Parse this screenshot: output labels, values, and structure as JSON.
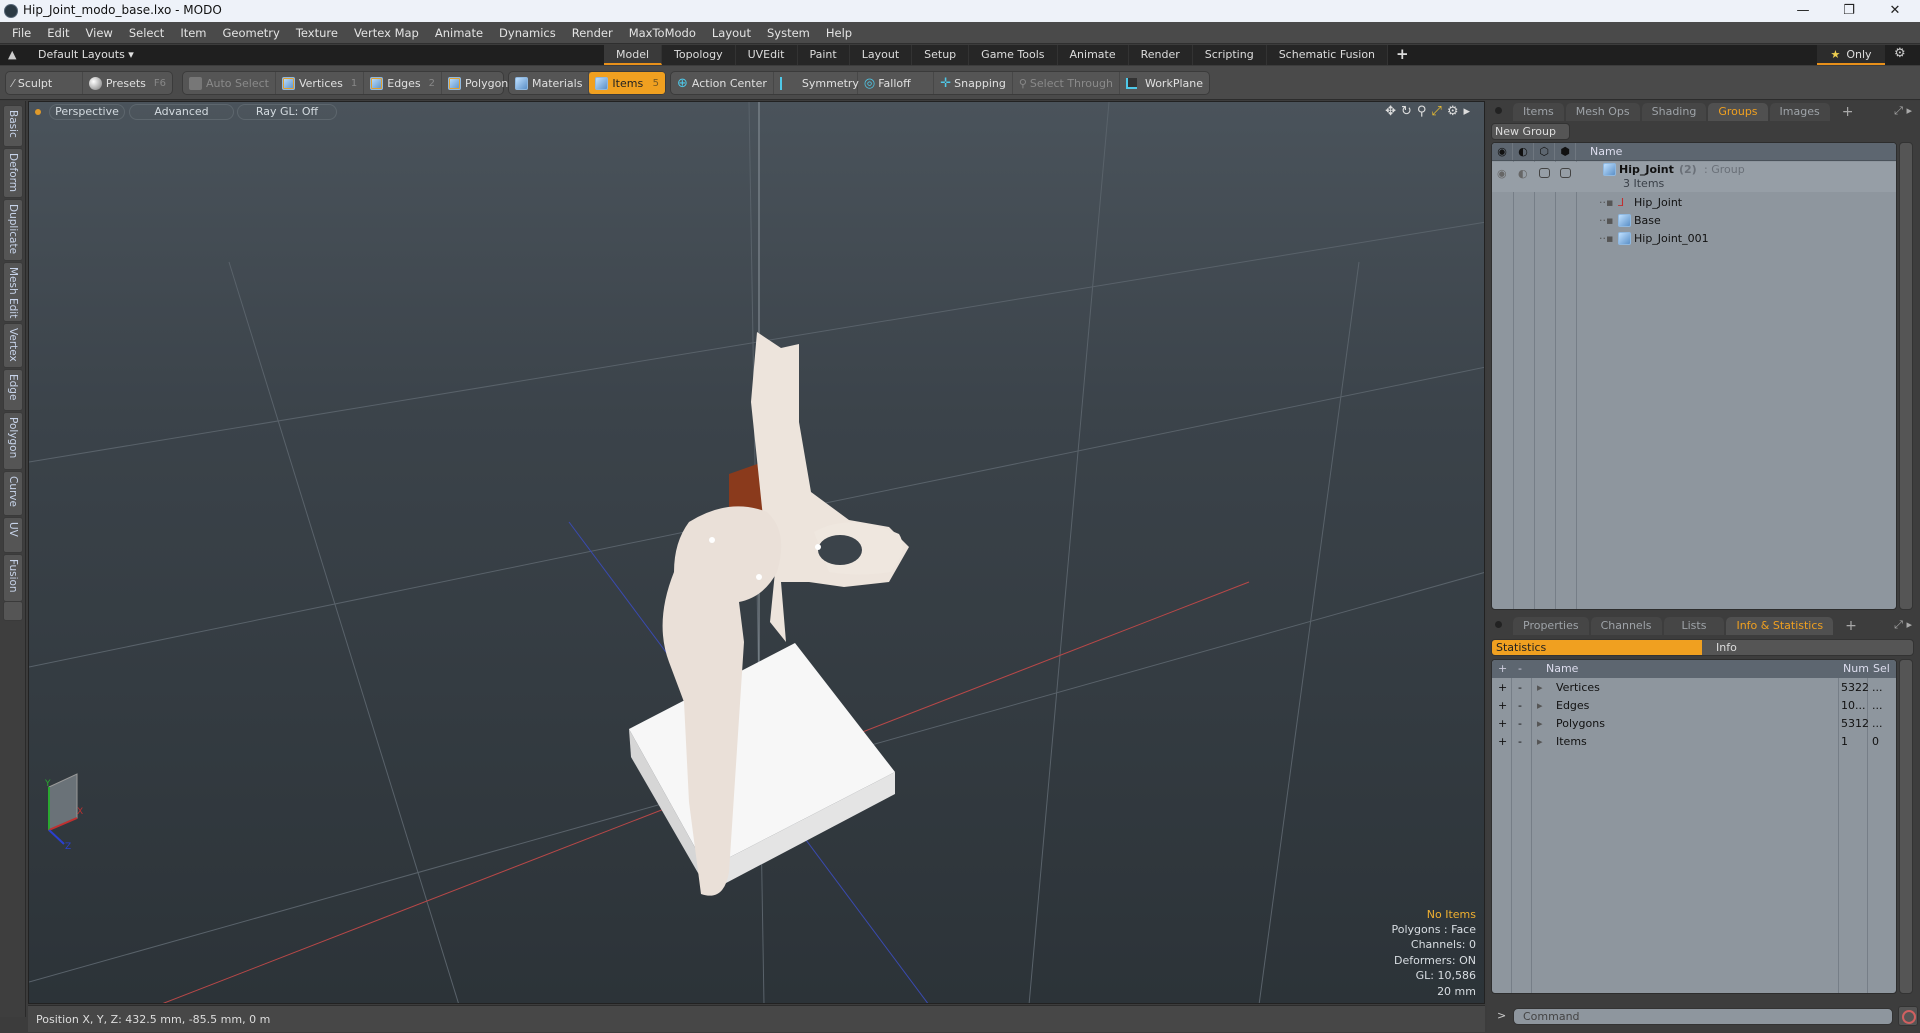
{
  "window": {
    "title": "Hip_Joint_modo_base.lxo - MODO",
    "minimize": "—",
    "maximize": "❐",
    "close": "✕"
  },
  "menu": [
    "File",
    "Edit",
    "View",
    "Select",
    "Item",
    "Geometry",
    "Texture",
    "Vertex Map",
    "Animate",
    "Dynamics",
    "Render",
    "MaxToModo",
    "Layout",
    "System",
    "Help"
  ],
  "layoutbar": {
    "layouts_label": "Default Layouts ▾",
    "tabs": [
      "Model",
      "Topology",
      "UVEdit",
      "Paint",
      "Layout",
      "Setup",
      "Game Tools",
      "Animate",
      "Render",
      "Scripting",
      "Schematic Fusion"
    ],
    "active_tab": "Model",
    "add_tab": "+",
    "only_label": "Only"
  },
  "toolbar": {
    "sculpt": "Sculpt",
    "presets": "Presets",
    "presets_key": "F6",
    "auto_select": "Auto Select",
    "vertices": "Vertices",
    "vertices_key": "1",
    "edges": "Edges",
    "edges_key": "2",
    "polygons": "Polygons",
    "materials": "Materials",
    "items": "Items",
    "items_key": "5",
    "action_center": "Action Center",
    "symmetry": "Symmetry",
    "falloff": "Falloff",
    "snapping": "Snapping",
    "select_through": "Select Through",
    "workplane": "WorkPlane"
  },
  "left_tabs": [
    "Basic",
    "Deform",
    "Duplicate",
    "Mesh Edit",
    "Vertex",
    "Edge",
    "Polygon",
    "Curve",
    "UV",
    "Fusion"
  ],
  "viewport": {
    "view_mode": "Perspective",
    "shading": "Advanced",
    "raygl": "Ray GL: Off",
    "info": {
      "selection": "No Items",
      "polygons": "Polygons : Face",
      "channels": "Channels: 0",
      "deformers": "Deformers: ON",
      "gl": "GL: 10,586",
      "grid": "20 mm"
    },
    "axis_labels": {
      "x": "X",
      "y": "Y",
      "z": "Z"
    }
  },
  "status": {
    "position": "Position X, Y, Z:   432.5 mm, -85.5 mm, 0 m"
  },
  "groups_panel": {
    "tabs": [
      "Items",
      "Mesh Ops",
      "Shading",
      "Groups",
      "Images"
    ],
    "active_tab": "Groups",
    "new_group": "New Group",
    "name_header": "Name",
    "group": {
      "name": "Hip_Joint",
      "count": "(2)",
      "type": ": Group",
      "items_label": "3 Items"
    },
    "children": [
      "Hip_Joint",
      "Base",
      "Hip_Joint_001"
    ]
  },
  "stats_panel": {
    "tabs": [
      "Properties",
      "Channels",
      "Lists",
      "Info & Statistics"
    ],
    "active_tab": "Info & Statistics",
    "subtabs": {
      "statistics": "Statistics",
      "info": "Info"
    },
    "headers": {
      "plus": "+",
      "minus": "-",
      "name": "Name",
      "num": "Num",
      "sel": "Sel"
    },
    "rows": [
      {
        "name": "Vertices",
        "num": "5322",
        "sel": "..."
      },
      {
        "name": "Edges",
        "num": "10...",
        "sel": "..."
      },
      {
        "name": "Polygons",
        "num": "5312",
        "sel": "..."
      },
      {
        "name": "Items",
        "num": "1",
        "sel": "0"
      }
    ]
  },
  "command": {
    "prompt": ">",
    "placeholder": "Command"
  }
}
